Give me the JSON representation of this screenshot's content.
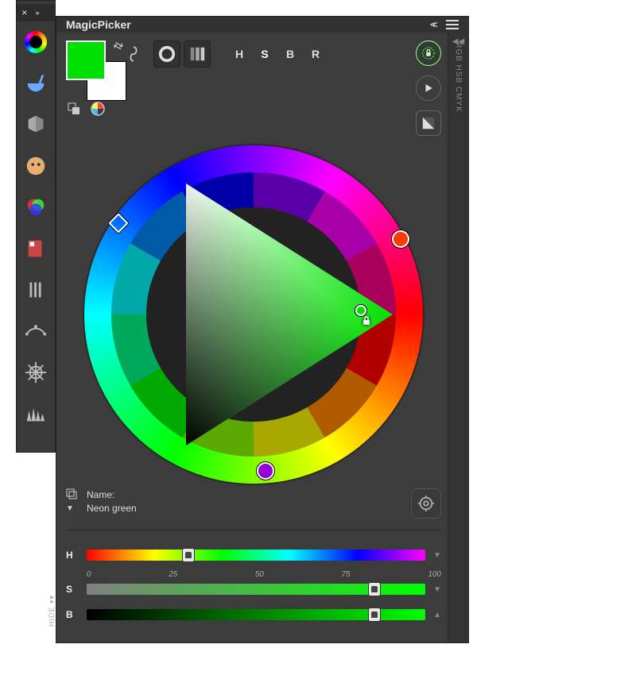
{
  "sidebar": {
    "icons": [
      "color-ring-icon",
      "mortar-icon",
      "cube-icon",
      "palette-face-icon",
      "rgb-circles-icon",
      "book-icon",
      "brushes-icon",
      "nodes-icon",
      "ship-wheel-icon",
      "grass-icon"
    ]
  },
  "panel": {
    "title": "MagicPicker"
  },
  "swatch": {
    "foreground": "#00E000",
    "background": "#FFFFFF"
  },
  "toolbar": {
    "buttons": [
      "ring-mode-icon",
      "gradient-bars-icon"
    ],
    "channels": [
      "H",
      "S",
      "B",
      "R"
    ]
  },
  "rightColumn": {
    "label": "RGB HSB CMYK"
  },
  "wheel": {
    "hueIndicatorAngleDeg": 120,
    "complements": [
      {
        "angleDeg": 300,
        "color": "#9400D3"
      },
      {
        "angleDeg": 10,
        "color": "#FF3A00"
      }
    ],
    "triangle": {
      "pickX": 0.82,
      "pickY": 0.52,
      "pickColor": "#00E000",
      "locked": true
    }
  },
  "colorName": {
    "label": "Name:",
    "value": "Neon green"
  },
  "sliders": {
    "scale": [
      "0",
      "25",
      "50",
      "75",
      "100"
    ],
    "H": {
      "label": "H",
      "value": 30,
      "thumbHasLock": true
    },
    "S": {
      "label": "S",
      "value": 85,
      "thumbHasLock": true
    },
    "B": {
      "label": "B",
      "value": 85,
      "thumbHasLock": true
    },
    "hideLabel": "HIDE"
  }
}
